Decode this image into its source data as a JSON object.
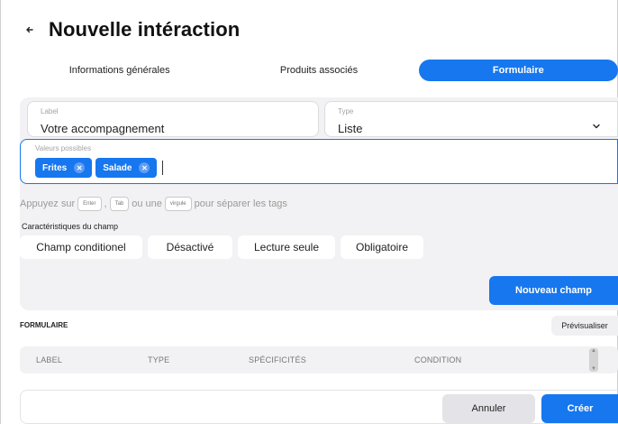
{
  "header": {
    "title": "Nouvelle intéraction",
    "back_icon": "arrow-left-icon"
  },
  "tabs": [
    {
      "label": "Informations générales",
      "active": false
    },
    {
      "label": "Produits associés",
      "active": false
    },
    {
      "label": "Formulaire",
      "active": true
    }
  ],
  "field_form": {
    "label_field": {
      "label": "Label",
      "value": "Votre accompagnement"
    },
    "type_field": {
      "label": "Type",
      "value": "Liste",
      "icon": "chevron-down-icon"
    },
    "values_field": {
      "label": "Valeurs possibles",
      "tags": [
        "Frites",
        "Salade"
      ],
      "remove_icon": "close-icon"
    },
    "hint": {
      "prefix": "Appuyez sur",
      "key_enter": "Enter",
      "sep1": ",",
      "key_tab": "Tab",
      "mid": "ou une",
      "key_comma": "virgule",
      "suffix": "pour séparer les tags"
    },
    "characteristics": {
      "title": "Caractéristiques du champ",
      "options": [
        "Champ conditionel",
        "Désactivé",
        "Lecture seule",
        "Obligatoire"
      ]
    },
    "new_field_label": "Nouveau champ"
  },
  "form_section": {
    "title": "FORMULAIRE",
    "preview_label": "Prévisualiser",
    "columns": [
      "LABEL",
      "TYPE",
      "SPÉCIFICITÉS",
      "CONDITION"
    ]
  },
  "footer": {
    "cancel_label": "Annuler",
    "create_label": "Créer"
  },
  "colors": {
    "accent": "#1677ef",
    "panel_bg": "#f2f2f4"
  }
}
